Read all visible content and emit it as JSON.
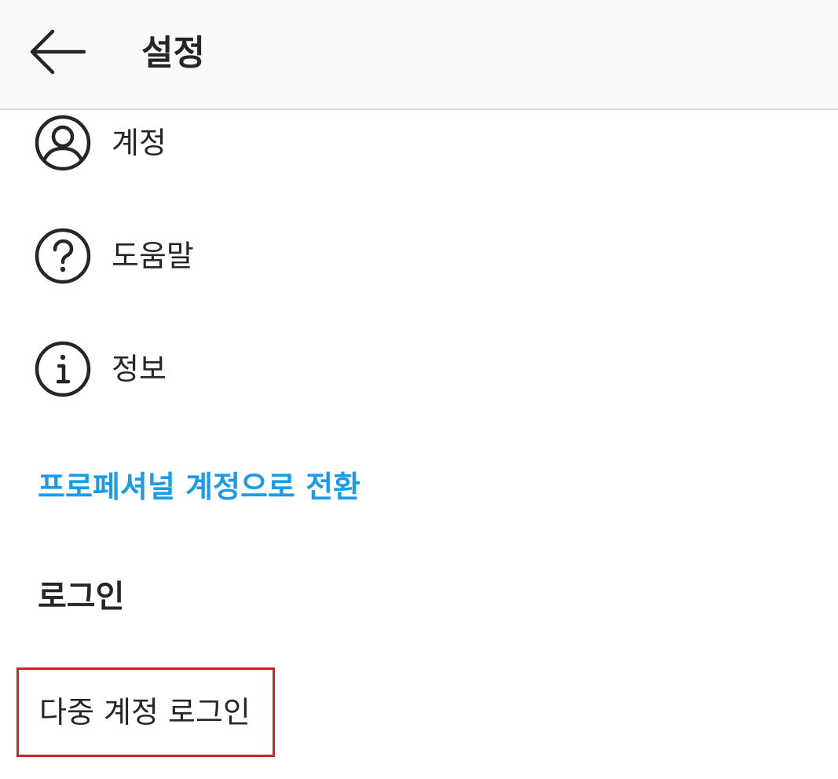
{
  "header": {
    "back_icon": "arrow-left-icon",
    "title": "설정"
  },
  "menu": {
    "items": [
      {
        "icon": "user-circle-icon",
        "label": "계정"
      },
      {
        "icon": "question-circle-icon",
        "label": "도움말"
      },
      {
        "icon": "info-circle-icon",
        "label": "정보"
      }
    ]
  },
  "switch_professional": {
    "label": "프로페셔널 계정으로 전환",
    "color": "#1e9be8"
  },
  "login_section": {
    "heading": "로그인",
    "multi_login": {
      "label": "다중 계정 로그인",
      "highlight_color": "#d21f2a"
    }
  },
  "colors": {
    "header_bg": "#fafafa",
    "text": "#262626",
    "divider": "#dbdbdb"
  }
}
